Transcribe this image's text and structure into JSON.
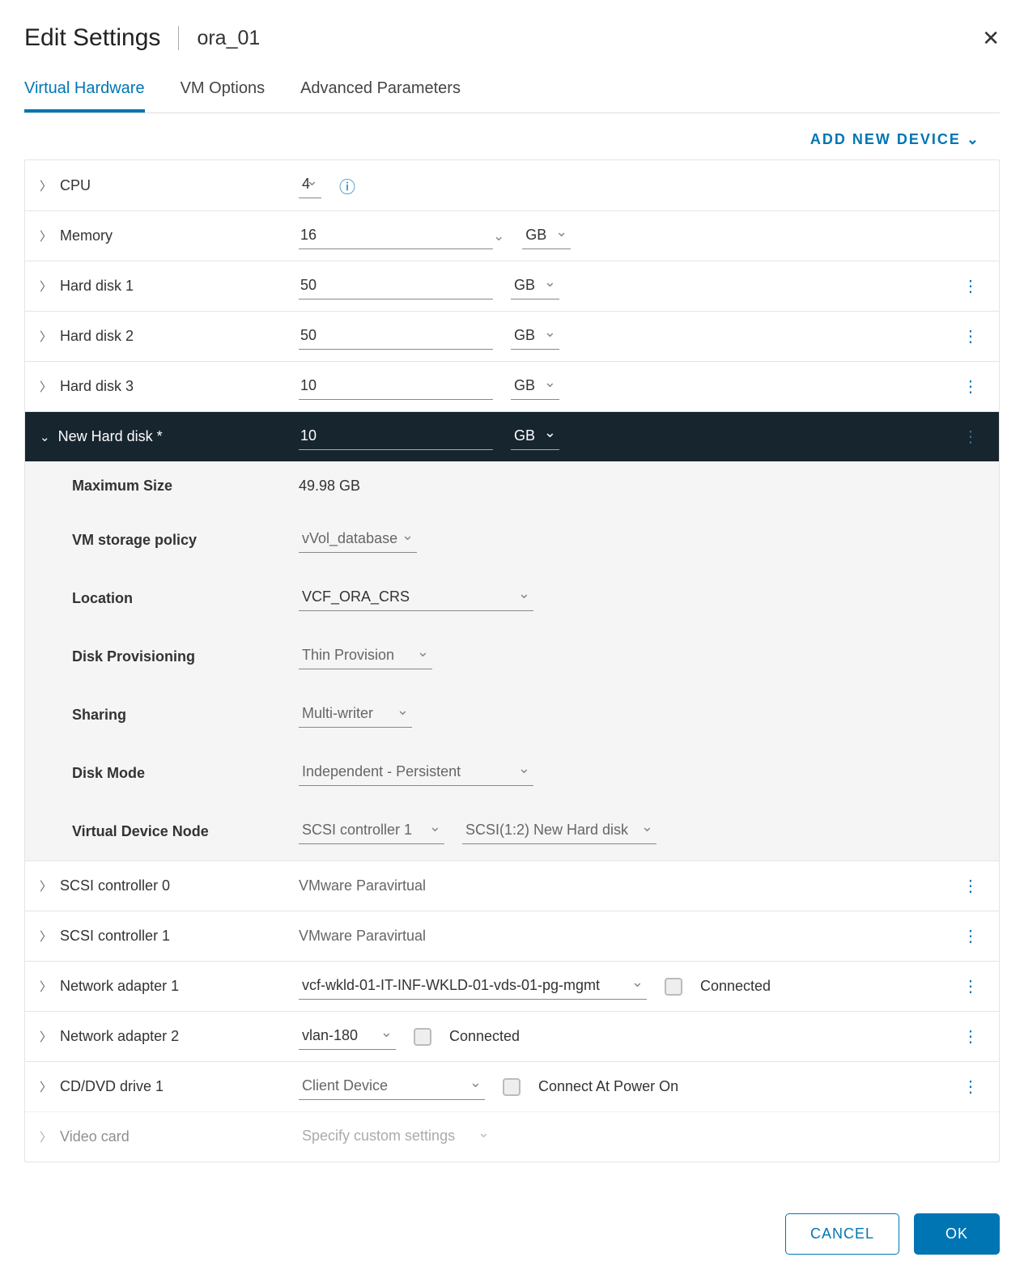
{
  "header": {
    "title": "Edit Settings",
    "subtitle": "ora_01"
  },
  "tabs": {
    "t1": "Virtual Hardware",
    "t2": "VM Options",
    "t3": "Advanced Parameters"
  },
  "add_device": "ADD NEW DEVICE",
  "rows": {
    "cpu_label": "CPU",
    "cpu_value": "4",
    "memory_label": "Memory",
    "memory_value": "16",
    "memory_unit": "GB",
    "hd1_label": "Hard disk 1",
    "hd1_value": "50",
    "hd1_unit": "GB",
    "hd2_label": "Hard disk 2",
    "hd2_value": "50",
    "hd2_unit": "GB",
    "hd3_label": "Hard disk 3",
    "hd3_value": "10",
    "hd3_unit": "GB",
    "newhd_label": "New Hard disk *",
    "newhd_value": "10",
    "newhd_unit": "GB",
    "scsi0_label": "SCSI controller 0",
    "scsi0_value": "VMware Paravirtual",
    "scsi1_label": "SCSI controller 1",
    "scsi1_value": "VMware Paravirtual",
    "net1_label": "Network adapter 1",
    "net1_value": "vcf-wkld-01-IT-INF-WKLD-01-vds-01-pg-mgmt",
    "net1_conn": "Connected",
    "net2_label": "Network adapter 2",
    "net2_value": "vlan-180",
    "net2_conn": "Connected",
    "cd_label": "CD/DVD drive 1",
    "cd_value": "Client Device",
    "cd_conn": "Connect At Power On",
    "video_label": "Video card",
    "video_value": "Specify custom settings"
  },
  "newhd": {
    "max_label": "Maximum Size",
    "max_value": "49.98 GB",
    "policy_label": "VM storage policy",
    "policy_value": "vVol_database",
    "location_label": "Location",
    "location_value": "VCF_ORA_CRS",
    "provisioning_label": "Disk Provisioning",
    "provisioning_value": "Thin Provision",
    "sharing_label": "Sharing",
    "sharing_value": "Multi-writer",
    "diskmode_label": "Disk Mode",
    "diskmode_value": "Independent - Persistent",
    "vdn_label": "Virtual Device Node",
    "vdn_ctrl": "SCSI controller 1",
    "vdn_slot": "SCSI(1:2) New Hard disk"
  },
  "footer": {
    "cancel": "CANCEL",
    "ok": "OK"
  }
}
